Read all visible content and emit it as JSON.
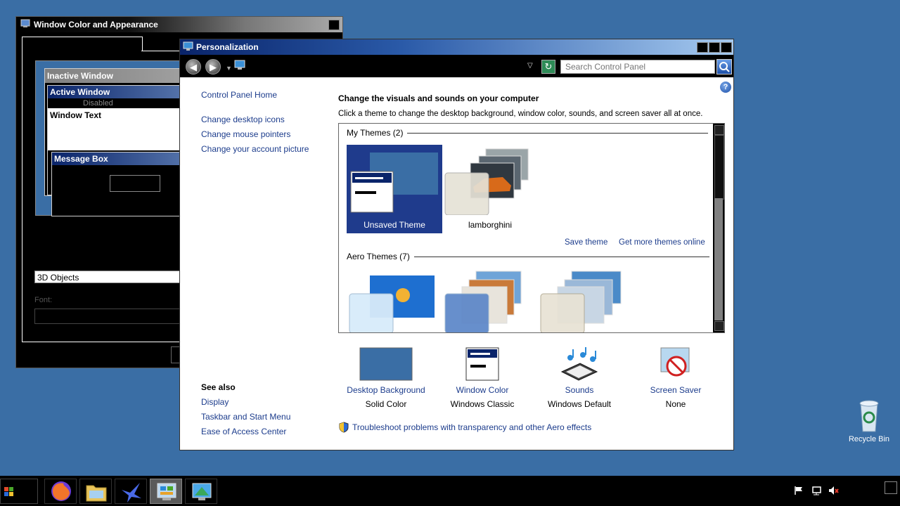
{
  "bg_window": {
    "title": "Window Color and Appearance",
    "preview": {
      "inactive_title": "Inactive Window",
      "active_title": "Active Window",
      "disabled_text": "Disabled",
      "window_text": "Window Text",
      "message_box_title": "Message Box"
    },
    "item_value": "3D Objects",
    "font_label": "Font:"
  },
  "main_window": {
    "title": "Personalization",
    "search_placeholder": "Search Control Panel",
    "sidebar": {
      "home": "Control Panel Home",
      "links": [
        "Change desktop icons",
        "Change mouse pointers",
        "Change your account picture"
      ],
      "see_also_title": "See also",
      "see_also": [
        "Display",
        "Taskbar and Start Menu",
        "Ease of Access Center"
      ]
    },
    "heading": "Change the visuals and sounds on your computer",
    "subheading": "Click a theme to change the desktop background, window color, sounds, and screen saver all at once.",
    "my_themes": {
      "title": "My Themes (2)",
      "items": [
        {
          "label": "Unsaved Theme",
          "selected": true
        },
        {
          "label": "lamborghini",
          "selected": false
        }
      ]
    },
    "actions": {
      "save": "Save theme",
      "more": "Get more themes online"
    },
    "aero_themes": {
      "title": "Aero Themes (7)"
    },
    "bottom": [
      {
        "caption": "Desktop Background",
        "value": "Solid Color"
      },
      {
        "caption": "Window Color",
        "value": "Windows Classic"
      },
      {
        "caption": "Sounds",
        "value": "Windows Default"
      },
      {
        "caption": "Screen Saver",
        "value": "None"
      }
    ],
    "troubleshoot": "Troubleshoot problems with transparency and other Aero effects"
  },
  "desktop": {
    "recycle_bin": "Recycle Bin"
  },
  "colors": {
    "desktop": "#3a6ea5",
    "selection": "#1f3b8c",
    "link": "#1c3c8c"
  }
}
